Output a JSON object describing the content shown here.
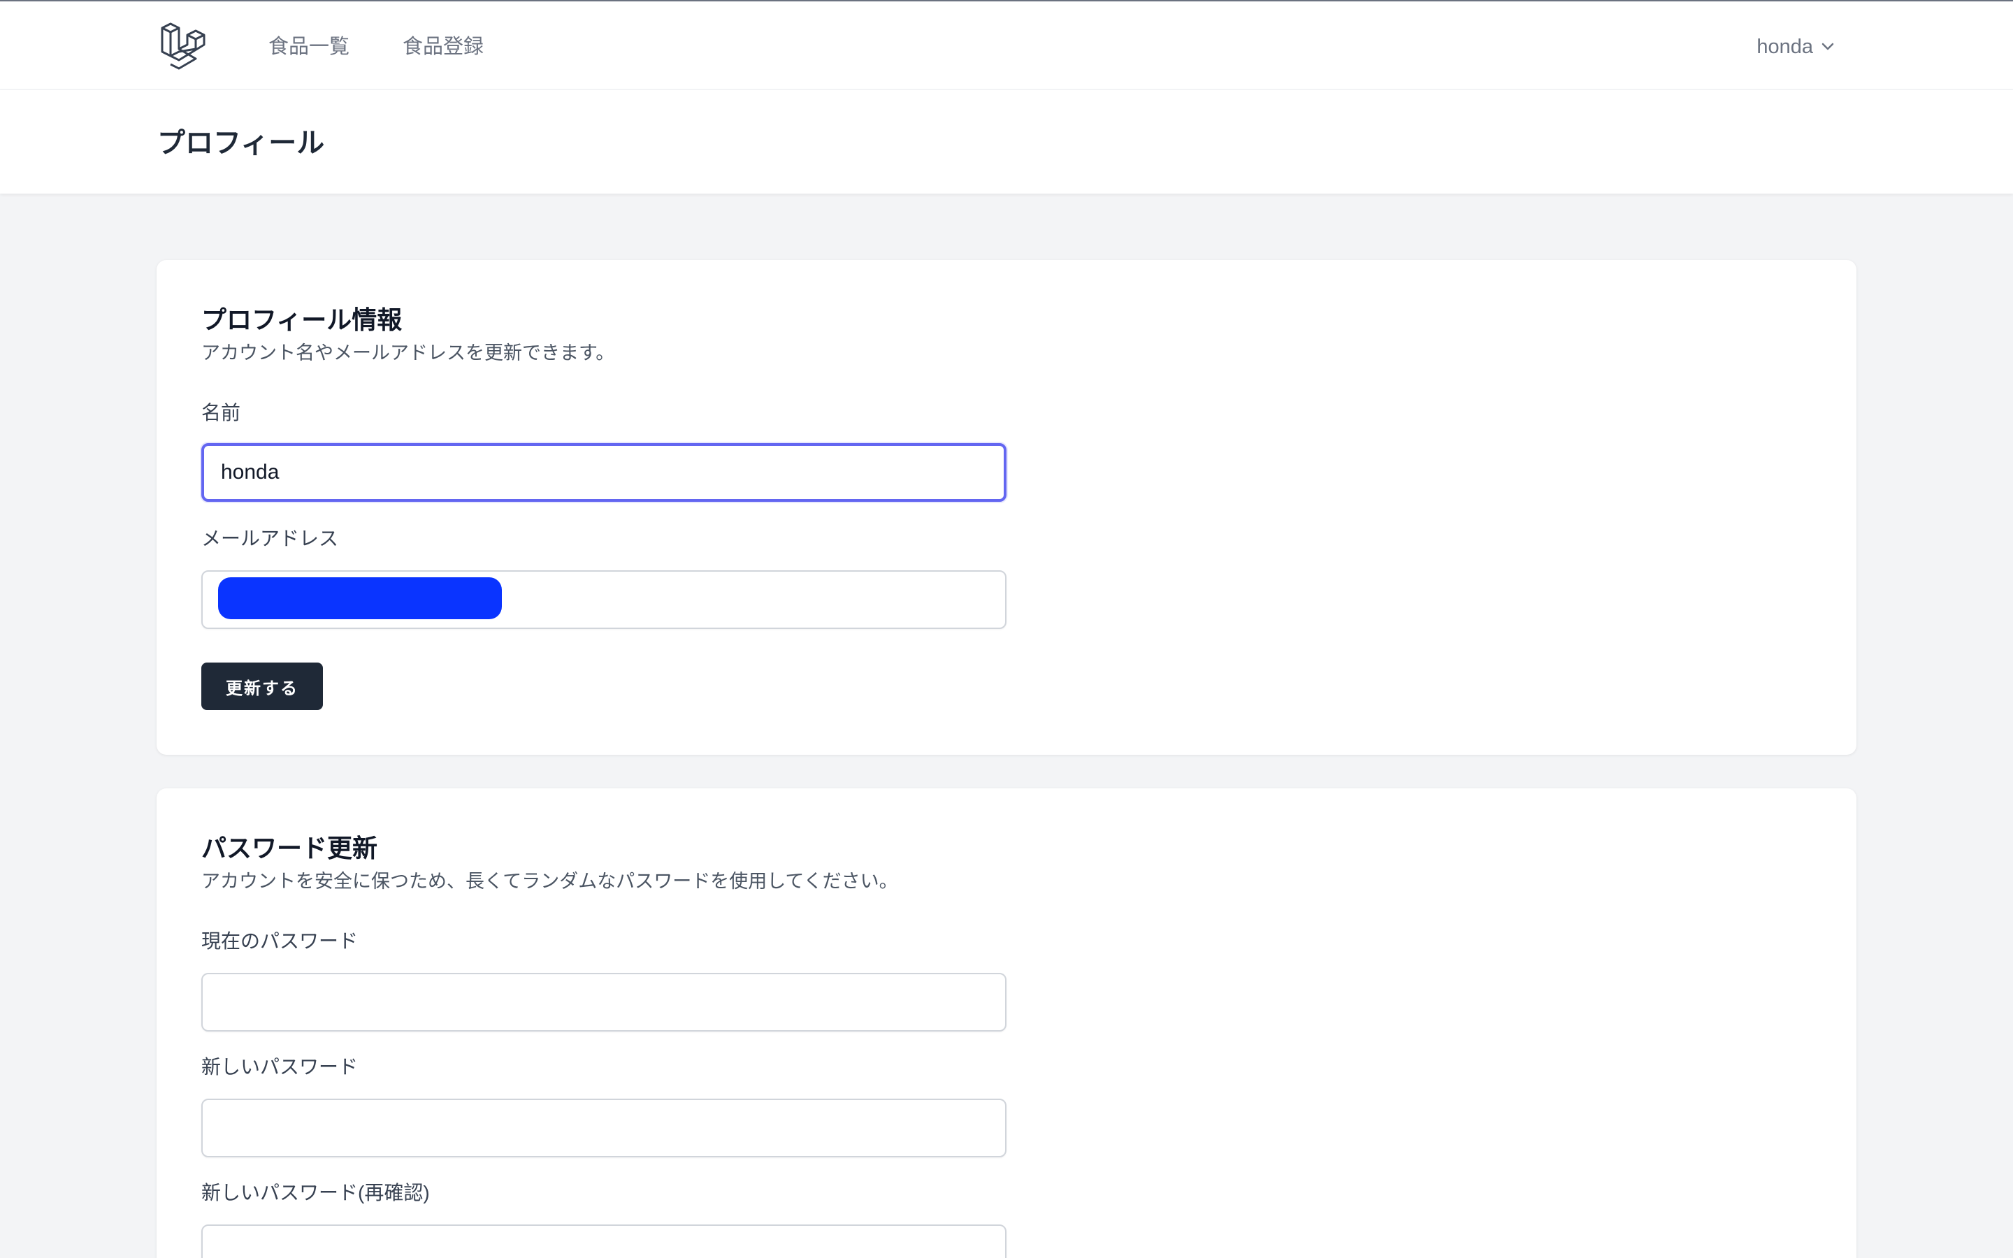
{
  "nav": {
    "links": [
      "食品一覧",
      "食品登録"
    ],
    "user_name": "honda"
  },
  "header": {
    "title": "プロフィール"
  },
  "profile_section": {
    "title": "プロフィール情報",
    "description": "アカウント名やメールアドレスを更新できます。",
    "name_label": "名前",
    "name_value": "honda",
    "email_label": "メールアドレス",
    "email_value": "",
    "submit_label": "更新する"
  },
  "password_section": {
    "title": "パスワード更新",
    "description": "アカウントを安全に保つため、長くてランダムなパスワードを使用してください。",
    "current_label": "現在のパスワード",
    "current_value": "",
    "new_label": "新しいパスワード",
    "new_value": "",
    "confirm_label": "新しいパスワード(再確認)",
    "confirm_value": ""
  },
  "colors": {
    "primary_button": "#1f2937",
    "focus_ring": "#6366f1",
    "redaction": "#0a34ff",
    "page_background": "#f3f4f6"
  },
  "icons": {
    "logo": "laravel-logo-icon",
    "user_dropdown": "chevron-down-icon"
  }
}
